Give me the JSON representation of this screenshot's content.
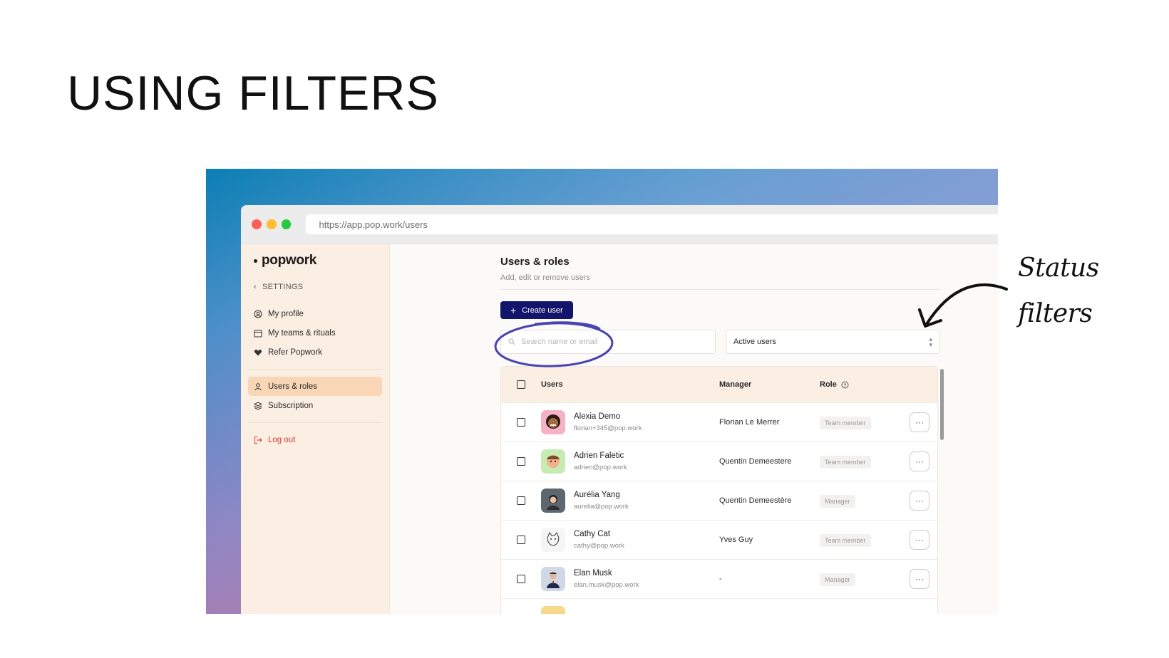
{
  "slide": {
    "title": "USING FILTERS"
  },
  "browser": {
    "url": "https://app.pop.work/users"
  },
  "sidebar": {
    "logo": "popwork",
    "back_label": "SETTINGS",
    "items": [
      {
        "label": "My profile",
        "icon": "user-circle-icon"
      },
      {
        "label": "My teams & rituals",
        "icon": "calendar-icon"
      },
      {
        "label": "Refer Popwork",
        "icon": "heart-icon"
      },
      {
        "label": "Users & roles",
        "icon": "user-icon"
      },
      {
        "label": "Subscription",
        "icon": "layers-icon"
      }
    ],
    "logout_label": "Log out"
  },
  "page": {
    "title": "Users & roles",
    "subtitle": "Add, edit or remove users",
    "create_button": "Create user",
    "search_placeholder": "Search name or email",
    "status_filter": "Active users"
  },
  "table": {
    "headers": {
      "users": "Users",
      "manager": "Manager",
      "role": "Role"
    },
    "rows": [
      {
        "name": "Alexia Demo",
        "email": "florian+345@pop.work",
        "manager": "Florian Le Merrer",
        "role": "Team member"
      },
      {
        "name": "Adrien Faletic",
        "email": "adrien@pop.work",
        "manager": "Quentin Demeestere",
        "role": "Team member"
      },
      {
        "name": "Aurélia Yang",
        "email": "aurelia@pop.work",
        "manager": "Quentin Demeestère",
        "role": "Manager"
      },
      {
        "name": "Cathy Cat",
        "email": "cathy@pop.work",
        "manager": "Yves Guy",
        "role": "Team member"
      },
      {
        "name": "Elan Musk",
        "email": "elan.musk@pop.work",
        "manager": "-",
        "role": "Manager"
      }
    ],
    "more_label": "···"
  },
  "annotation": {
    "line1": "Status",
    "line2": "filters"
  },
  "colors": {
    "accent": "#13146c",
    "sidebar_bg": "#fbeee2",
    "active_item": "#f8d6b6",
    "annotation_circle": "#4a44b0",
    "logout": "#d73434"
  }
}
